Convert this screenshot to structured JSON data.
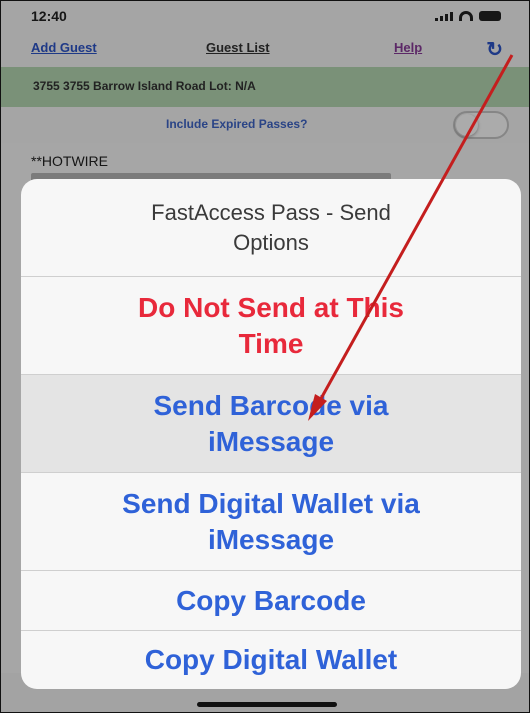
{
  "status_bar": {
    "time": "12:40"
  },
  "nav": {
    "add_guest": "Add Guest",
    "guest_list": "Guest List",
    "help": "Help",
    "refresh_icon": "refresh-icon"
  },
  "address": {
    "text": "3755 3755 Barrow Island Road Lot: N/A"
  },
  "expired": {
    "label": "Include Expired Passes?",
    "toggle_on": false
  },
  "entry": {
    "title": "**HOTWIRE"
  },
  "sheet": {
    "title": "FastAccess Pass - Send Options",
    "options": [
      {
        "label": "Do Not Send at This Time"
      },
      {
        "label": "Send Barcode via iMessage"
      },
      {
        "label": "Send Digital Wallet via iMessage"
      },
      {
        "label": "Copy Barcode"
      },
      {
        "label": "Copy Digital Wallet"
      }
    ]
  },
  "colors": {
    "destructive": "#e8293b",
    "action": "#2f62d8",
    "annotation_arrow": "#c41e1e",
    "address_bar": "#b6d8b4"
  }
}
